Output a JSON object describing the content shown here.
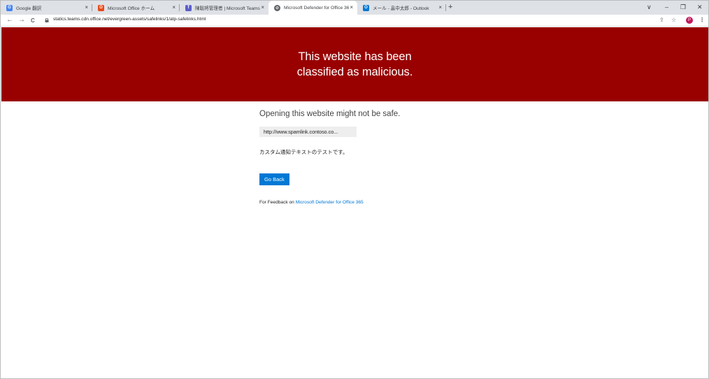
{
  "browser": {
    "tabs": [
      {
        "title": "Google 翻訳",
        "fav_color": "#4285f4",
        "fav_glyph": "G"
      },
      {
        "title": "Microsoft Office ホーム",
        "fav_color": "#e64a19",
        "fav_glyph": "O"
      },
      {
        "title": "陳聡将管理者 | Microsoft Teams",
        "fav_color": "#5b5fc7",
        "fav_glyph": "T"
      },
      {
        "title": "Microsoft Defender for Office 36",
        "fav_color": "#5f6368",
        "fav_glyph": "⊘"
      },
      {
        "title": "メール - 畠中太郎 - Outlook",
        "fav_color": "#0078d4",
        "fav_glyph": "O"
      }
    ],
    "active_tab_index": 3,
    "close_glyph": "×",
    "new_tab_glyph": "+",
    "url": "statics.teams.cdn.office.net/evergreen-assets/safelinks/1/atp-safelinks.html",
    "nav": {
      "back": "←",
      "forward": "→",
      "reload": "C"
    },
    "toolbar_icons": {
      "share": "⇪",
      "bookmark": "☆",
      "menu": "⋮"
    },
    "profile_initial": "P",
    "window_controls": {
      "tab_search": "∨",
      "minimize": "–",
      "restore": "❐",
      "close": "✕"
    }
  },
  "page": {
    "banner_title": "This website has been classified as malicious.",
    "subtitle": "Opening this website might not be safe.",
    "blocked_url": "http://www.spamlink.contoso.co...",
    "custom_text": "カスタム通知テキストのテストです。",
    "go_back_label": "Go Back",
    "feedback_prefix": "For Feedback on",
    "feedback_link": "Microsoft Defender for Office 365"
  },
  "colors": {
    "banner": "#990000",
    "accent": "#0078d4"
  }
}
